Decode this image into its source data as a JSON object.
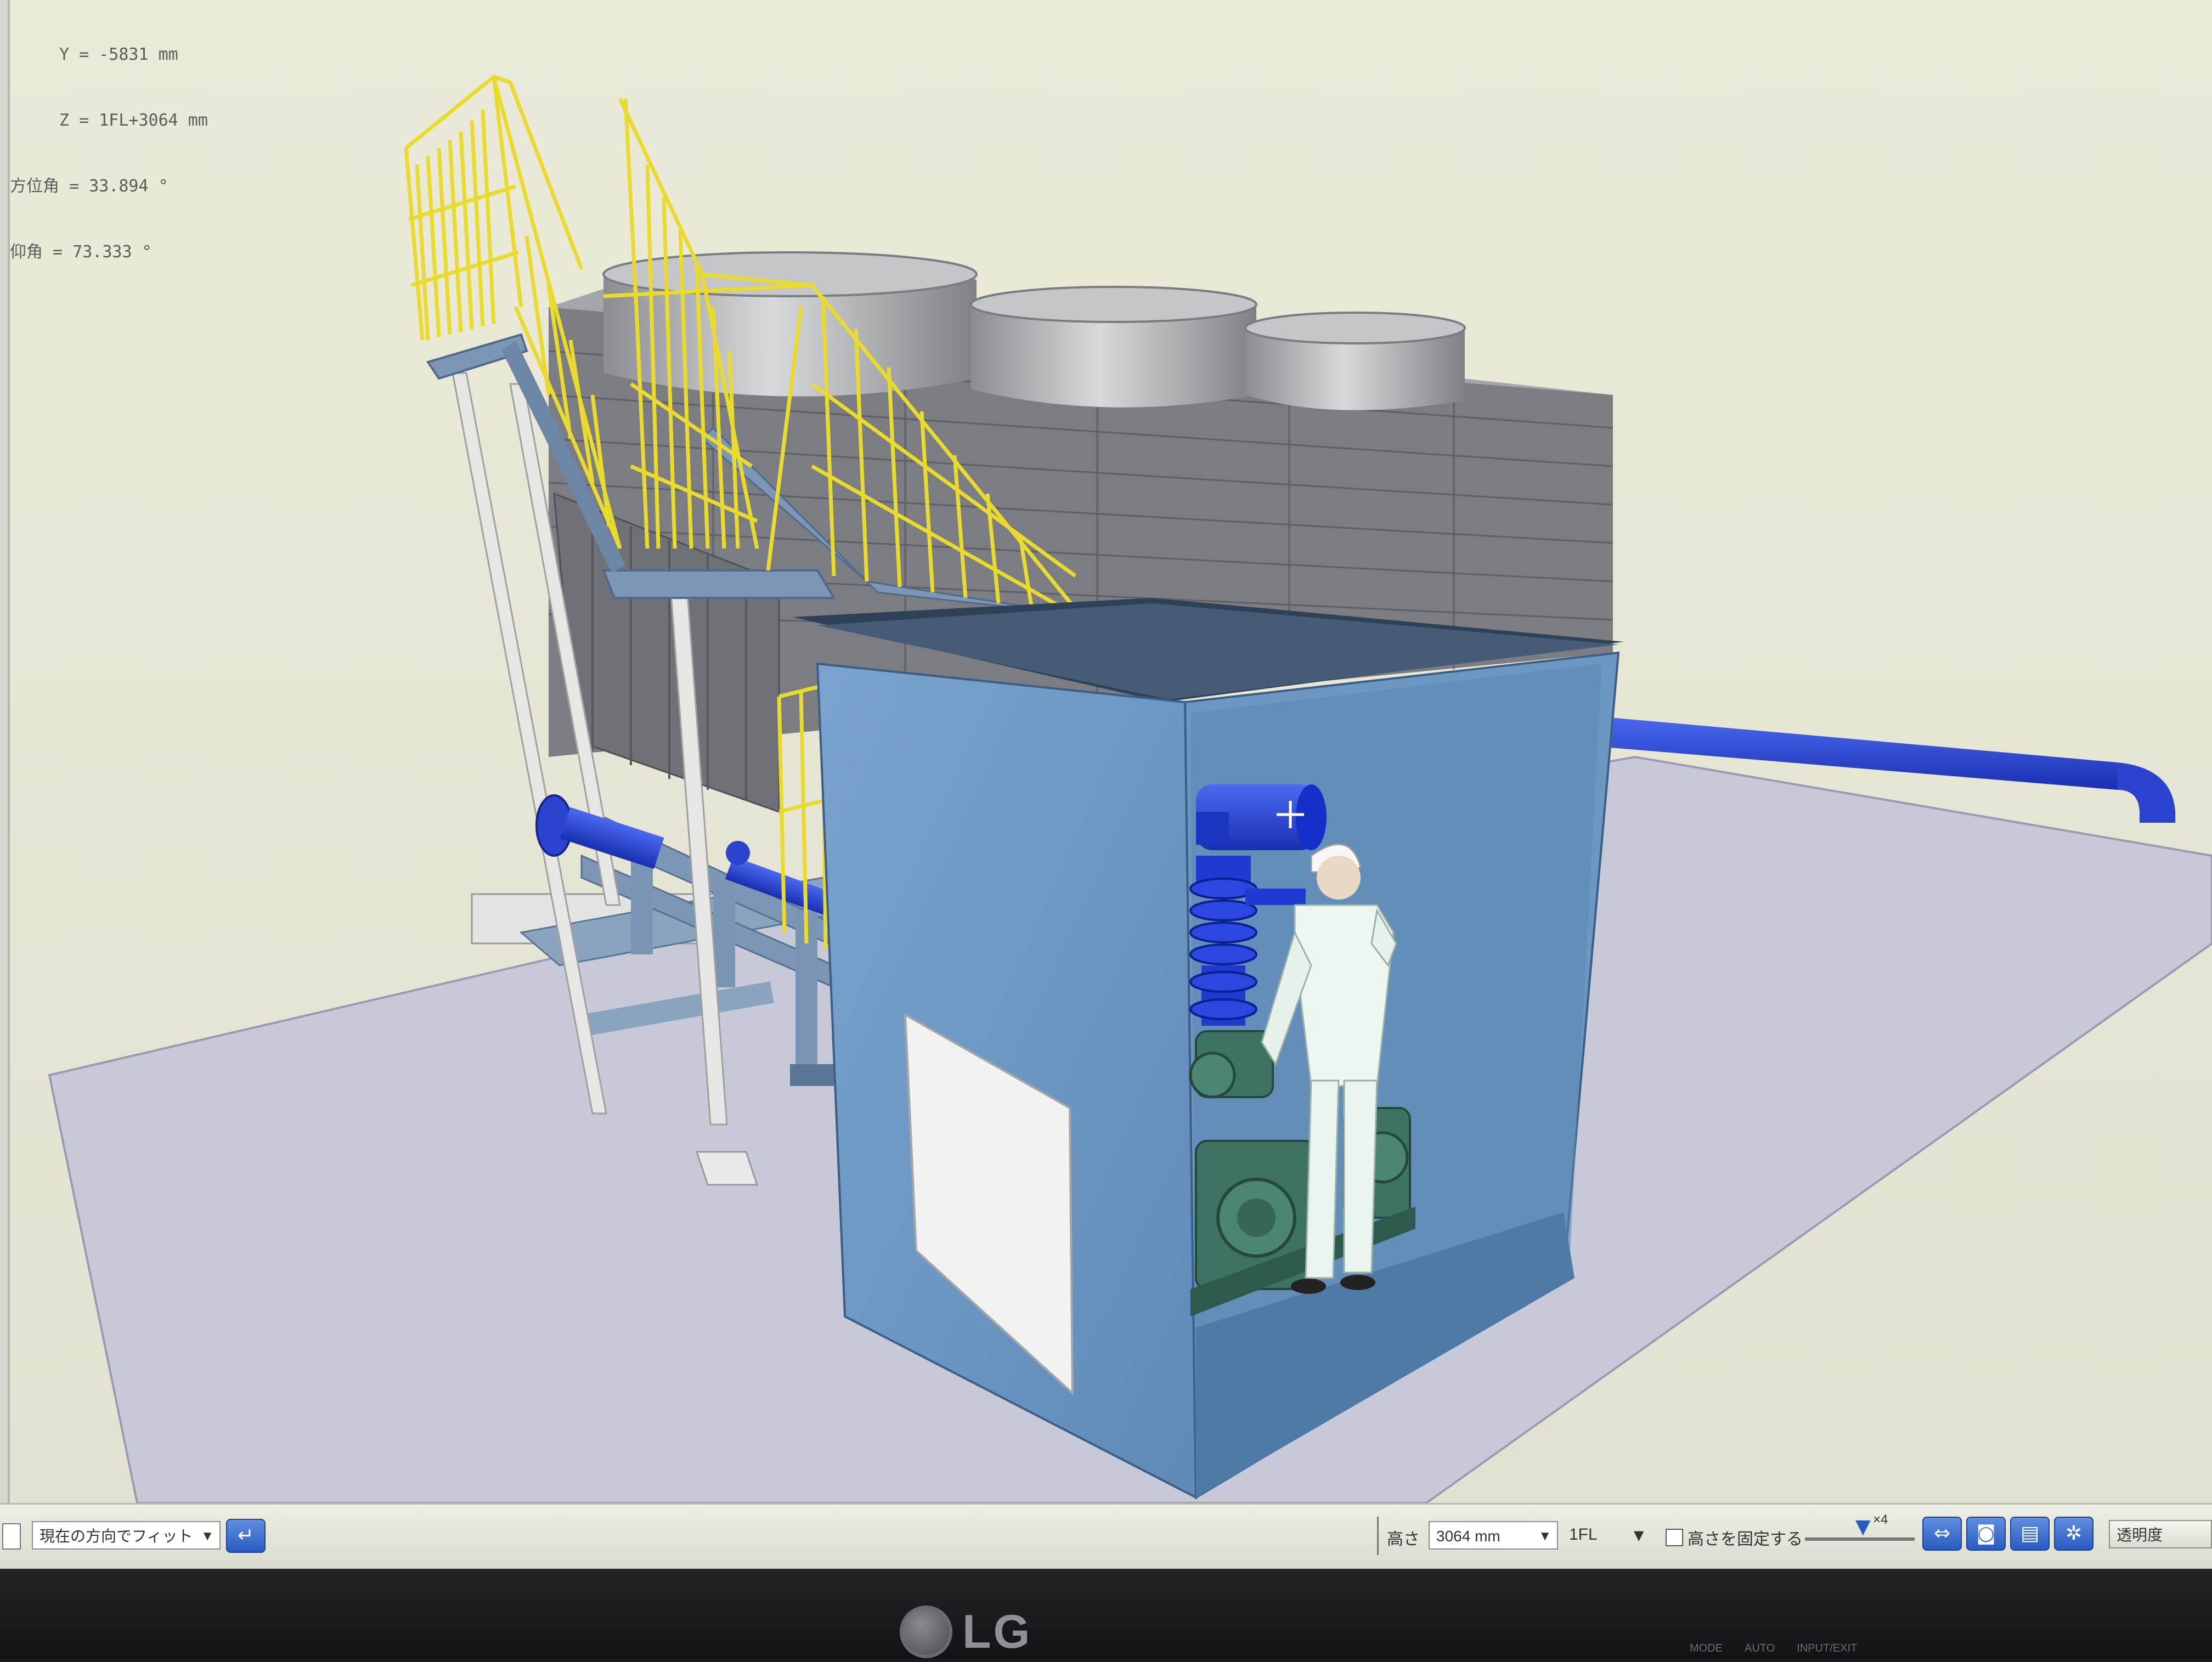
{
  "coords": {
    "y_line": "Y = -5831 mm",
    "z_line": "Z = 1FL+3064 mm",
    "azimuth_line": "方位角 = 33.894 °",
    "elevation_line": "仰角 = 73.333 °"
  },
  "toolbar": {
    "fit_mode": "現在の方向でフィット",
    "height_label": "高さ",
    "height_value": "3064 mm",
    "floor_value": "1FL",
    "fix_height_label": "高さを固定する",
    "zoom_label": "×4",
    "transparency_label": "透明度"
  },
  "monitor": {
    "brand": "LG",
    "buttons": [
      "MODE",
      "AUTO",
      "INPUT/EXIT"
    ]
  },
  "colors": {
    "background": "#e9e8d9",
    "enclosure": "#6e9ac4",
    "pipe": "#1f3fd6",
    "railing": "#f1e43a",
    "cooling_tower": "#8d8f94",
    "floor": "#c9cad8"
  },
  "icons": [
    "enter-icon",
    "double-arrow-icon",
    "camera-icon",
    "print-icon",
    "gear-icon"
  ]
}
